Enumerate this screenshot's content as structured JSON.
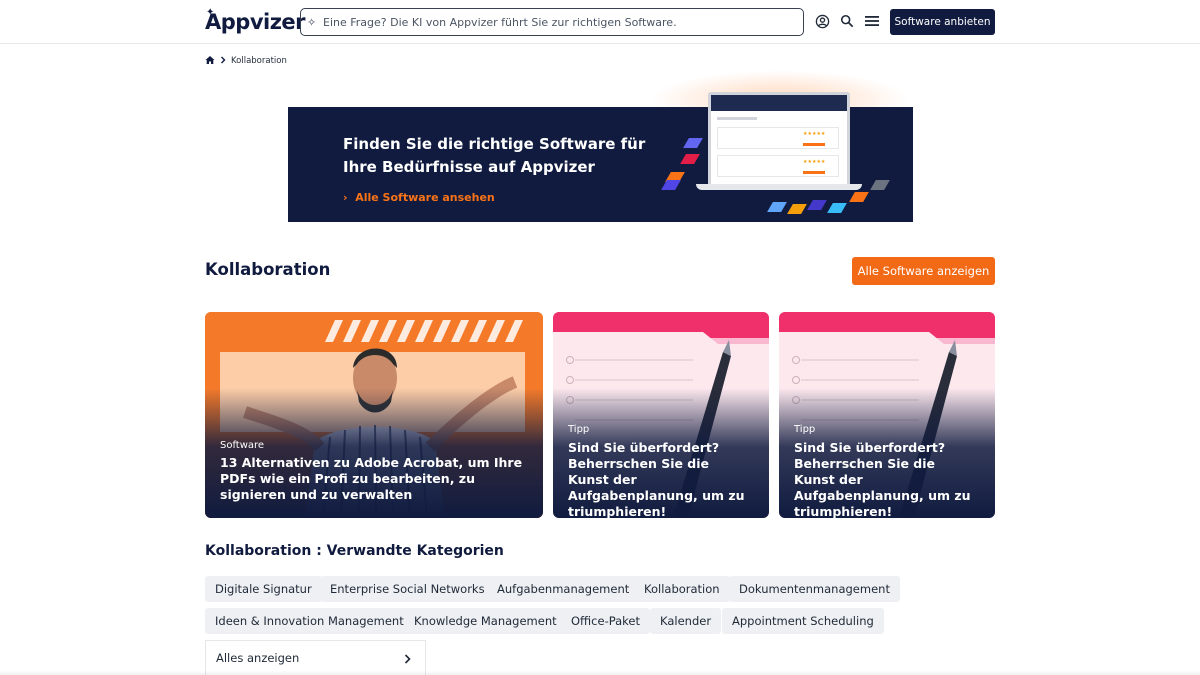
{
  "header": {
    "logo": "Appvizer",
    "search_placeholder": "Eine Frage? Die KI von Appvizer führt Sie zur richtigen Software.",
    "cta": "Software anbieten"
  },
  "breadcrumb": {
    "current": "Kollaboration"
  },
  "banner": {
    "title": "Finden Sie die richtige Software für Ihre Bedürfnisse auf Appvizer",
    "link": "Alle Software ansehen",
    "colors": {
      "background": "#101b3f",
      "accent": "#f97316"
    }
  },
  "section": {
    "title": "Kollaboration",
    "all_button": "Alle Software anzeigen"
  },
  "cards": [
    {
      "category": "Software",
      "title": "13 Alternativen zu Adobe Acrobat, um Ihre PDFs wie ein Profi zu bearbeiten, zu signieren und zu verwalten"
    },
    {
      "category": "Tipp",
      "title": "Sind Sie überfordert? Beherrschen Sie die Kunst der Aufgabenplanung, um zu triumphieren!"
    },
    {
      "category": "Tipp",
      "title": "Sind Sie überfordert? Beherrschen Sie die Kunst der Aufgabenplanung, um zu triumphieren!"
    }
  ],
  "related": {
    "title": "Kollaboration : Verwandte Kategorien",
    "chips": [
      "Digitale Signatur",
      "Enterprise Social Networks",
      "Aufgabenmanagement",
      "Kollaboration",
      "Dokumentenmanagement",
      "Ideen & Innovation Management",
      "Knowledge Management",
      "Office-Paket",
      "Kalender",
      "Appointment Scheduling"
    ],
    "show_all": "Alles anzeigen"
  },
  "theme": {
    "navy": "#101b3f",
    "orange": "#f26a16",
    "chip_bg": "#eef0f3"
  }
}
